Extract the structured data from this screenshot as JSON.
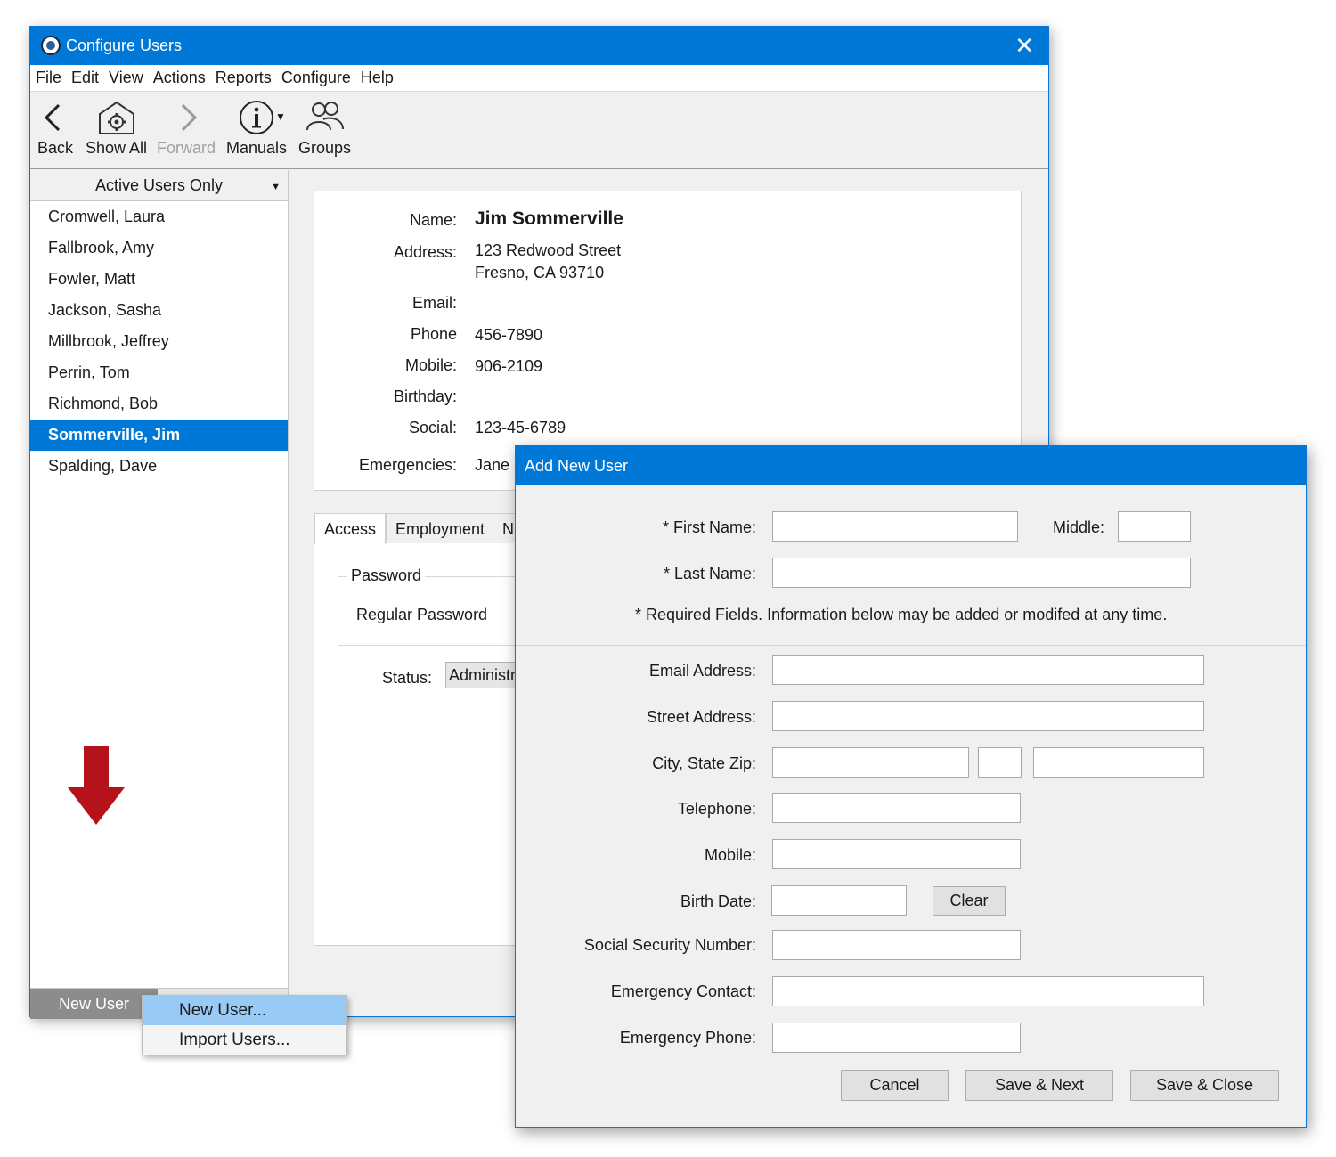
{
  "window": {
    "title": "Configure Users",
    "close_glyph": "✕",
    "menu": [
      "File",
      "Edit",
      "View",
      "Actions",
      "Reports",
      "Configure",
      "Help"
    ],
    "toolbar": {
      "back": "Back",
      "show_all": "Show All",
      "forward": "Forward",
      "manuals": "Manuals",
      "groups": "Groups"
    }
  },
  "sidebar": {
    "filter": "Active Users Only",
    "users": [
      "Cromwell, Laura",
      "Fallbrook, Amy",
      "Fowler, Matt",
      "Jackson, Sasha",
      "Millbrook, Jeffrey",
      "Perrin, Tom",
      "Richmond, Bob",
      "Sommerville, Jim",
      "Spalding, Dave"
    ],
    "selected_user": "Sommerville, Jim",
    "new_user_button": "New User"
  },
  "popup_menu": {
    "items": [
      "New User...",
      "Import Users..."
    ]
  },
  "detail": {
    "labels": {
      "name": "Name:",
      "address": "Address:",
      "email": "Email:",
      "phone": "Phone",
      "mobile": "Mobile:",
      "birthday": "Birthday:",
      "social": "Social:",
      "emergencies": "Emergencies:"
    },
    "values": {
      "name": "Jim Sommerville",
      "address_line1": "123 Redwood Street",
      "address_line2": "Fresno, CA 93710",
      "phone": "456-7890",
      "mobile": "906-2109",
      "social": "123-45-6789",
      "emergencies": "Jane"
    },
    "tabs": [
      "Access",
      "Employment",
      "N"
    ],
    "password_group_title": "Password",
    "password_text": "Regular Password",
    "status_label": "Status:",
    "status_value": "Administr"
  },
  "dialog": {
    "title": "Add New User",
    "labels": {
      "first_name": "* First Name:",
      "middle": "Middle:",
      "last_name": "* Last Name:",
      "email": "Email Address:",
      "street": "Street Address:",
      "city_state_zip": "City, State Zip:",
      "telephone": "Telephone:",
      "mobile": "Mobile:",
      "birth_date": "Birth Date:",
      "ssn": "Social Security Number:",
      "emergency_contact": "Emergency Contact:",
      "emergency_phone": "Emergency Phone:"
    },
    "note": "* Required Fields.  Information below may be added or modifed at any time.",
    "buttons": {
      "clear": "Clear",
      "cancel": "Cancel",
      "save_next": "Save & Next",
      "save_close": "Save & Close"
    }
  },
  "colors": {
    "titlebar": "#0078d7",
    "selection": "#0078d7",
    "menu_highlight": "#99c9f5",
    "arrow": "#b5121b"
  }
}
